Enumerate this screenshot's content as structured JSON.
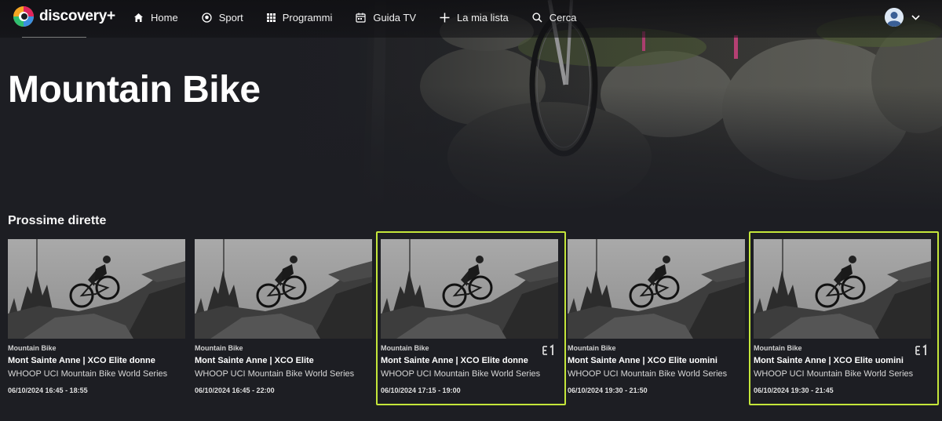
{
  "brand": {
    "name": "discovery+"
  },
  "nav": {
    "items": [
      {
        "label": "Home",
        "icon": "home-icon"
      },
      {
        "label": "Sport",
        "icon": "sport-ball-icon"
      },
      {
        "label": "Programmi",
        "icon": "grid-icon"
      },
      {
        "label": "Guida TV",
        "icon": "calendar-icon"
      },
      {
        "label": "La mia lista",
        "icon": "plus-icon"
      },
      {
        "label": "Cerca",
        "icon": "search-icon"
      }
    ]
  },
  "page": {
    "title": "Mountain Bike"
  },
  "section": {
    "title": "Prossime dirette"
  },
  "cards": [
    {
      "category": "Mountain Bike",
      "title": "Mont Sainte Anne | XCO Elite donne",
      "subtitle": "WHOOP UCI Mountain Bike World Series",
      "time": "06/10/2024 16:45 - 18:55",
      "channel_badge": false,
      "highlighted": false
    },
    {
      "category": "Mountain Bike",
      "title": "Mont Sainte Anne | XCO Elite",
      "subtitle": "WHOOP UCI Mountain Bike World Series",
      "time": "06/10/2024 16:45 - 22:00",
      "channel_badge": false,
      "highlighted": false
    },
    {
      "category": "Mountain Bike",
      "title": "Mont Sainte Anne | XCO Elite donne",
      "subtitle": "WHOOP UCI Mountain Bike World Series",
      "time": "06/10/2024 17:15 - 19:00",
      "channel_badge": true,
      "highlighted": true
    },
    {
      "category": "Mountain Bike",
      "title": "Mont Sainte Anne | XCO Elite uomini",
      "subtitle": "WHOOP UCI Mountain Bike World Series",
      "time": "06/10/2024 19:30 - 21:50",
      "channel_badge": false,
      "highlighted": false
    },
    {
      "category": "Mountain Bike",
      "title": "Mont Sainte Anne | XCO Elite uomini",
      "subtitle": "WHOOP UCI Mountain Bike World Series",
      "time": "06/10/2024 19:30 - 21:45",
      "channel_badge": true,
      "highlighted": true
    }
  ],
  "colors": {
    "highlight": "#c4e63a",
    "background": "#1d1e23"
  }
}
